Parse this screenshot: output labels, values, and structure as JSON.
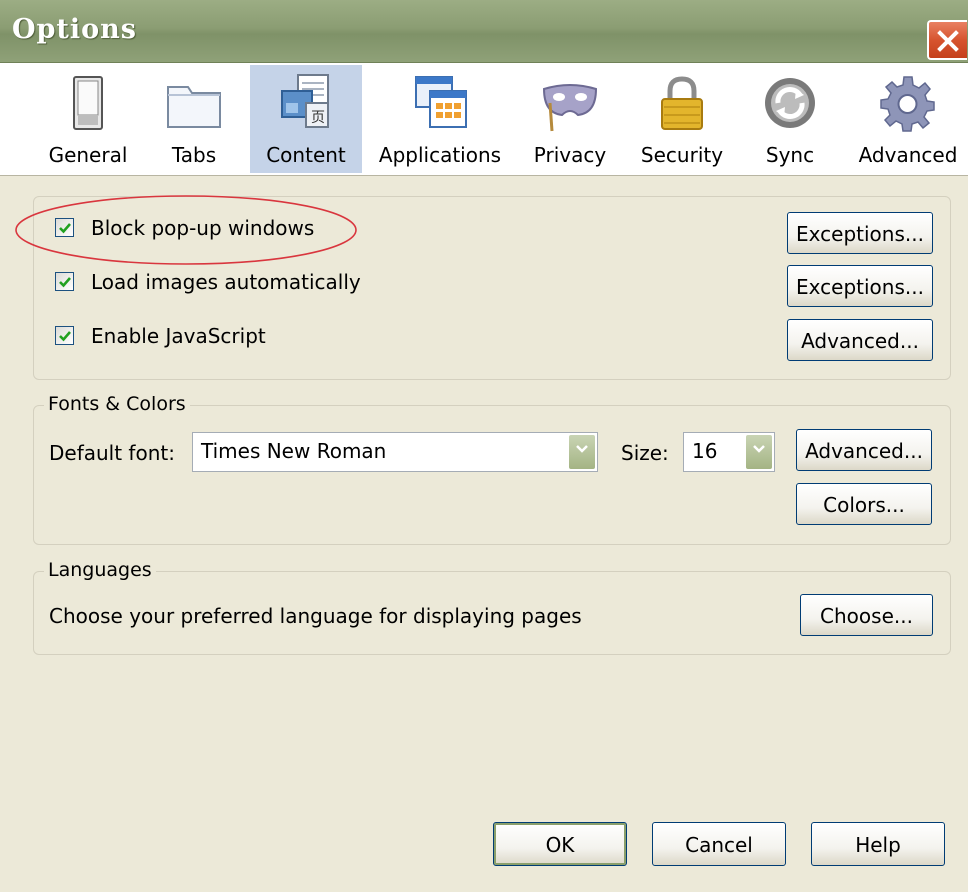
{
  "window": {
    "title": "Options",
    "close_icon": "close-icon"
  },
  "toolbar": {
    "selected": "Content",
    "panes": [
      {
        "label": "General",
        "icon": "switch-icon"
      },
      {
        "label": "Tabs",
        "icon": "folder-tabs-icon"
      },
      {
        "label": "Content",
        "icon": "content-page-icon"
      },
      {
        "label": "Applications",
        "icon": "applications-window-icon"
      },
      {
        "label": "Privacy",
        "icon": "mask-icon"
      },
      {
        "label": "Security",
        "icon": "padlock-icon"
      },
      {
        "label": "Sync",
        "icon": "sync-arrows-icon"
      },
      {
        "label": "Advanced",
        "icon": "gear-icon"
      }
    ]
  },
  "content": {
    "block_popups": {
      "label": "Block pop-up windows",
      "checked": true,
      "exceptions_label": "Exceptions..."
    },
    "load_images": {
      "label": "Load images automatically",
      "checked": true,
      "exceptions_label": "Exceptions..."
    },
    "enable_javascript": {
      "label": "Enable JavaScript",
      "checked": true,
      "advanced_label": "Advanced..."
    }
  },
  "fonts_colors": {
    "caption": "Fonts & Colors",
    "default_font_label": "Default font:",
    "default_font_value": "Times New Roman",
    "size_label": "Size:",
    "size_value": "16",
    "advanced_label": "Advanced...",
    "colors_label": "Colors..."
  },
  "languages": {
    "caption": "Languages",
    "description": "Choose your preferred language for displaying pages",
    "choose_label": "Choose..."
  },
  "footer": {
    "ok_label": "OK",
    "cancel_label": "Cancel",
    "help_label": "Help"
  },
  "colors": {
    "titlebar": "#8b9d73",
    "dialog_bg": "#ece9d8",
    "selected_pane": "#c5d3e8",
    "close_button": "#d7542f",
    "highlight_ellipse": "#d9363e",
    "check_mark": "#21a121"
  }
}
